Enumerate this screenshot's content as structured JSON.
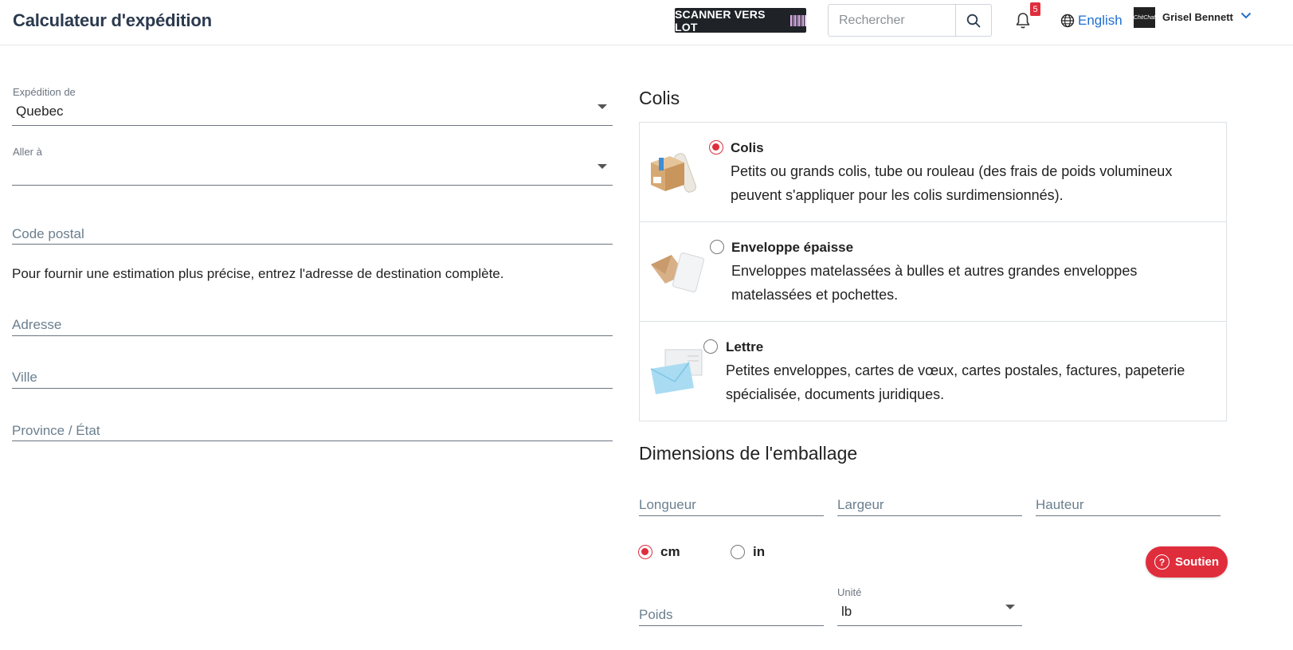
{
  "header": {
    "title": "Calculateur d'expédition",
    "scan_button": "SCANNER VERS LOT",
    "search_placeholder": "Rechercher",
    "notifications_count": "5",
    "language": "English",
    "avatar_text": "ChitChat",
    "user_name": "Grisel Bennett"
  },
  "form": {
    "from_label": "Expédition de",
    "from_value": "Quebec",
    "to_label": "Aller à",
    "to_value": "",
    "postal_code_placeholder": "Code postal",
    "info_text": "Pour fournir une estimation plus précise, entrez l'adresse de destination complète.",
    "address_placeholder": "Adresse",
    "city_placeholder": "Ville",
    "province_placeholder": "Province / État"
  },
  "package": {
    "section_title": "Colis",
    "options": [
      {
        "title": "Colis",
        "description": "Petits ou grands colis, tube ou rouleau (des frais de poids volumineux peuvent s'appliquer pour les colis surdimensionnés).",
        "selected": true
      },
      {
        "title": "Enveloppe épaisse",
        "description": "Enveloppes matelassées à bulles et autres grandes enveloppes matelassées et pochettes.",
        "selected": false
      },
      {
        "title": "Lettre",
        "description": "Petites enveloppes, cartes de vœux, cartes postales, factures, papeterie spécialisée, documents juridiques.",
        "selected": false
      }
    ]
  },
  "dimensions": {
    "section_title": "Dimensions de l'emballage",
    "length_placeholder": "Longueur",
    "width_placeholder": "Largeur",
    "height_placeholder": "Hauteur",
    "unit_cm": "cm",
    "unit_in": "in",
    "selected_unit": "cm",
    "weight_placeholder": "Poids",
    "weight_unit_label": "Unité",
    "weight_unit_value": "lb"
  },
  "support_button": "Soutien",
  "colors": {
    "accent_red": "#e02d3c",
    "link_blue": "#1f6fd1",
    "title_navy": "#2b3a4e"
  }
}
